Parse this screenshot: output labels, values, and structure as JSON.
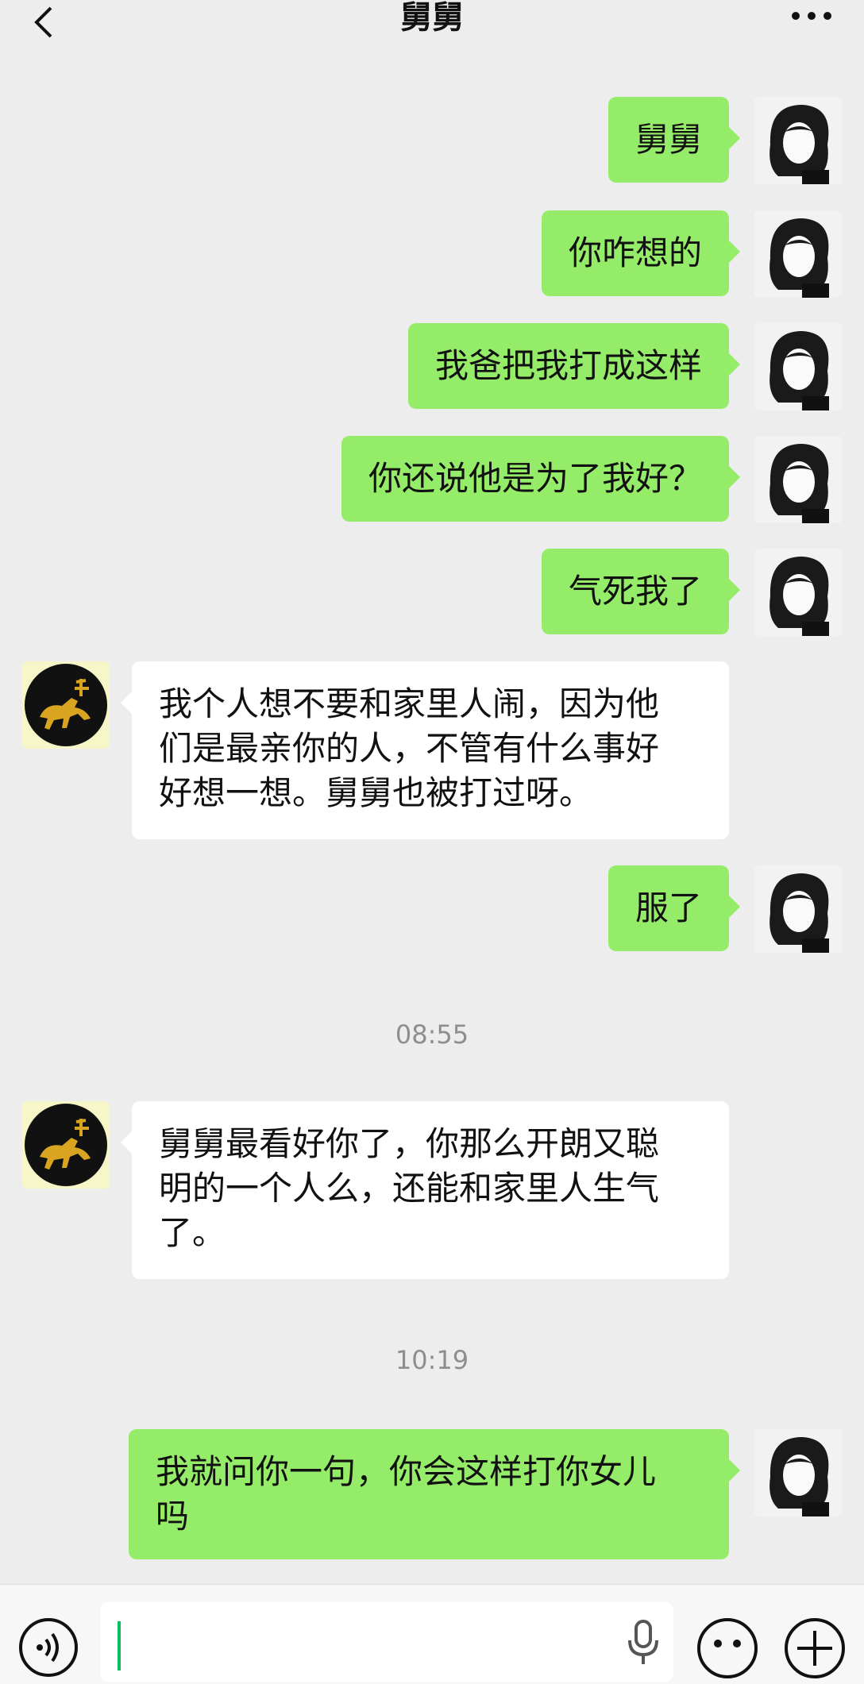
{
  "header": {
    "title": "舅舅",
    "back_icon": "chevron-left-icon",
    "more_icon": "ellipsis-icon"
  },
  "messages": [
    {
      "from": "me",
      "text": "舅舅"
    },
    {
      "from": "me",
      "text": "你咋想的"
    },
    {
      "from": "me",
      "text": "我爸把我打成这样"
    },
    {
      "from": "me",
      "text": "你还说他是为了我好？"
    },
    {
      "from": "me",
      "text": "气死我了"
    },
    {
      "from": "them",
      "text": "我个人想不要和家里人闹，因为他\n们是最亲你的人，不管有什么事好\n好想一想。舅舅也被打过呀。"
    },
    {
      "from": "me",
      "text": "服了"
    },
    {
      "from": "time",
      "text": "08:55"
    },
    {
      "from": "them",
      "text": "舅舅最看好你了，你那么开朗又聪\n明的一个人么，还能和家里人生气\n了。"
    },
    {
      "from": "time",
      "text": "10:19"
    },
    {
      "from": "me",
      "text": "我就问你一句，你会这样打你女儿\n吗"
    }
  ],
  "input_bar": {
    "value": "",
    "voice_icon": "voice-mode-icon",
    "mic_icon": "microphone-icon",
    "emoji_icon": "emoji-icon",
    "more_icon": "plus-icon"
  },
  "colors": {
    "background": "#ededed",
    "my_bubble": "#95ec69",
    "their_bubble": "#ffffff",
    "accent": "#07c160"
  }
}
